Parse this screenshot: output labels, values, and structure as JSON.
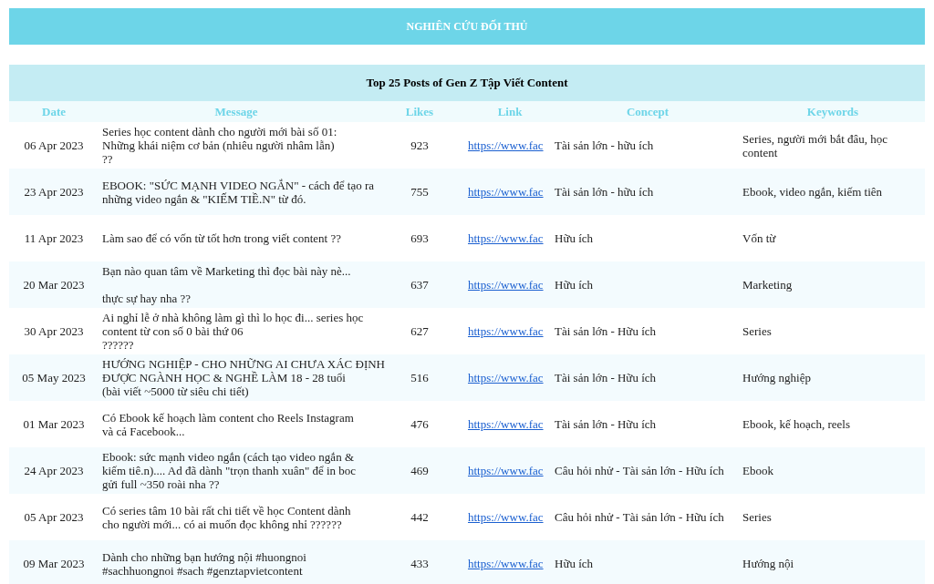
{
  "banner": {
    "title": "NGHIÊN CỨU ĐỐI THỦ"
  },
  "table": {
    "title": "Top 25 Posts of Gen Z Tập Viết Content",
    "columns": [
      "Date",
      "Message",
      "Likes",
      "Link",
      "Concept",
      "Keywords"
    ],
    "rows": [
      {
        "date": "06 Apr 2023",
        "message": "Series học content dành cho người mới bài số 01:\nNhững khái niệm cơ bản (nhiêu người nhâm lẫn)\n??",
        "likes": "923",
        "link": "https://www.fac",
        "concept": "Tài sản lớn - hữu ích",
        "keywords": "Series, người mới bắt đâu, học\ncontent"
      },
      {
        "date": "23 Apr 2023",
        "message": "EBOOK: \"SỨC MẠNH VIDEO NGẮN\" - cách để tạo ra\nnhững video ngắn & \"KIẾM TIỀ.N\" từ đó.",
        "likes": "755",
        "link": "https://www.fac",
        "concept": "Tài sản lớn - hữu ích",
        "keywords": "Ebook, video ngắn, kiếm tiên"
      },
      {
        "date": "11 Apr 2023",
        "message": "Làm sao để có vốn từ tốt hơn trong viết content ??",
        "likes": "693",
        "link": "https://www.fac",
        "concept": "Hữu ích",
        "keywords": "Vốn từ"
      },
      {
        "date": "20 Mar 2023",
        "message": "Bạn nào quan tâm về Marketing thì đọc bài này nè...\n\nthực sự hay nha ??",
        "likes": "637",
        "link": "https://www.fac",
        "concept": "Hữu ích",
        "keywords": "Marketing"
      },
      {
        "date": "30 Apr 2023",
        "message": "Ai nghỉ lễ ở nhà không làm gì thì lo học đi... series học\ncontent từ con số 0 bài thứ 06\n??????",
        "likes": "627",
        "link": "https://www.fac",
        "concept": "Tài sản lớn - Hữu ích",
        "keywords": "Series"
      },
      {
        "date": "05 May 2023",
        "message": "HƯỚNG NGHIỆP - CHO NHỮNG AI CHƯA XÁC ĐỊNH\nĐƯỢC NGÀNH HỌC & NGHỀ LÀM 18 - 28 tuổi\n(bài viết ~5000 từ siêu chi tiết)",
        "likes": "516",
        "link": "https://www.fac",
        "concept": "Tài sản lớn - Hữu ích",
        "keywords": "Hướng nghiệp"
      },
      {
        "date": "01 Mar 2023",
        "message": "Có Ebook kế hoạch làm content cho Reels Instagram\nvà cả Facebook...",
        "likes": "476",
        "link": "https://www.fac",
        "concept": "Tài sản lớn - Hữu ích",
        "keywords": "Ebook, kế hoạch, reels"
      },
      {
        "date": "24 Apr 2023",
        "message": "Ebook: sức mạnh video ngắn (cách tạo video ngắn &\nkiếm tiê.n).... Ad đã dành \"trọn thanh xuân\" để in boc\ngửi full ~350 roài nha ??",
        "likes": "469",
        "link": "https://www.fac",
        "concept": "Câu hỏi nhử - Tài sản lớn - Hữu ích",
        "keywords": "Ebook"
      },
      {
        "date": "05 Apr 2023",
        "message": "Có series tâm 10 bài rất chi tiết về học Content dành\ncho người mới... có ai muốn đọc không nhỉ ??????",
        "likes": "442",
        "link": "https://www.fac",
        "concept": "Câu hỏi nhử - Tài sản lớn - Hữu ích",
        "keywords": "Series"
      },
      {
        "date": "09 Mar 2023",
        "message": "Dành cho những bạn hướng nội #huongnoi\n#sachhuongnoi #sach #genztapvietcontent",
        "likes": "433",
        "link": "https://www.fac",
        "concept": "Hữu ích",
        "keywords": "Hướng nội"
      }
    ]
  }
}
